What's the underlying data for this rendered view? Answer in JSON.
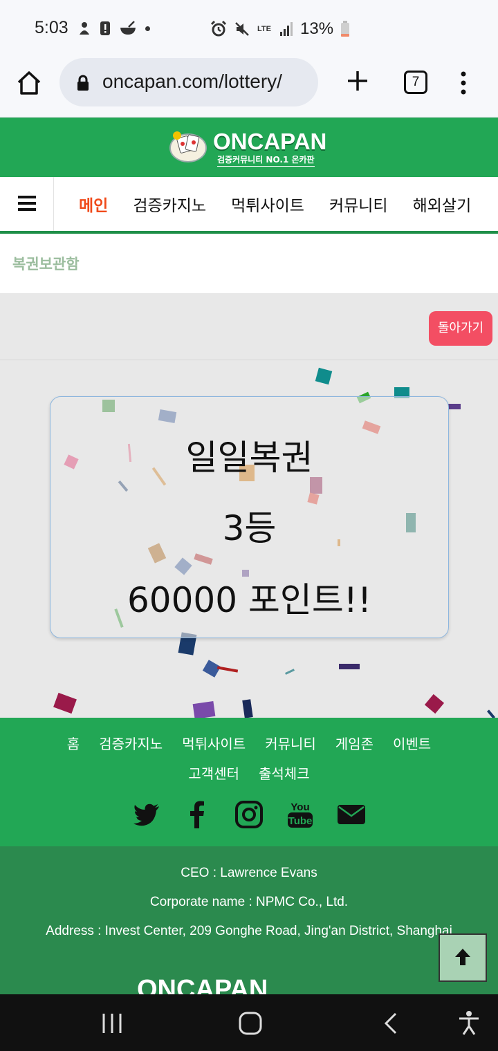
{
  "status_bar": {
    "time": "5:03",
    "battery": "13%",
    "network": "LTE"
  },
  "browser": {
    "url": "oncapan.com/lottery/",
    "tab_count": "7"
  },
  "site": {
    "logo_text": "ONCAPAN",
    "logo_sub": "검증커뮤니티 NO.1 온카판"
  },
  "nav": {
    "items": [
      "메인",
      "검증카지노",
      "먹튀사이트",
      "커뮤니티",
      "해외살기"
    ]
  },
  "breadcrumb": "복권보관함",
  "back_button": "돌아가기",
  "result": {
    "title": "일일복권",
    "rank": "3등",
    "prize": "60000 포인트!!"
  },
  "footer": {
    "links_row1": [
      "홈",
      "검증카지노",
      "먹튀사이트",
      "커뮤니티",
      "게임존",
      "이벤트"
    ],
    "links_row2": [
      "고객센터",
      "출석체크"
    ],
    "social": [
      "twitter-icon",
      "facebook-icon",
      "instagram-icon",
      "youtube-icon",
      "email-icon"
    ],
    "ceo": "CEO : Lawrence Evans",
    "corporate": "Corporate name : NPMC Co., Ltd.",
    "address": "Address : Invest Center, 209 Gonghe Road, Jing'an District, Shanghai",
    "logo_text": "ONCAPAN"
  },
  "colors": {
    "brand_green": "#22a755",
    "footer_dark_green": "#2b8a4e",
    "active_nav": "#f04a1a",
    "back_button": "#f34e63"
  }
}
